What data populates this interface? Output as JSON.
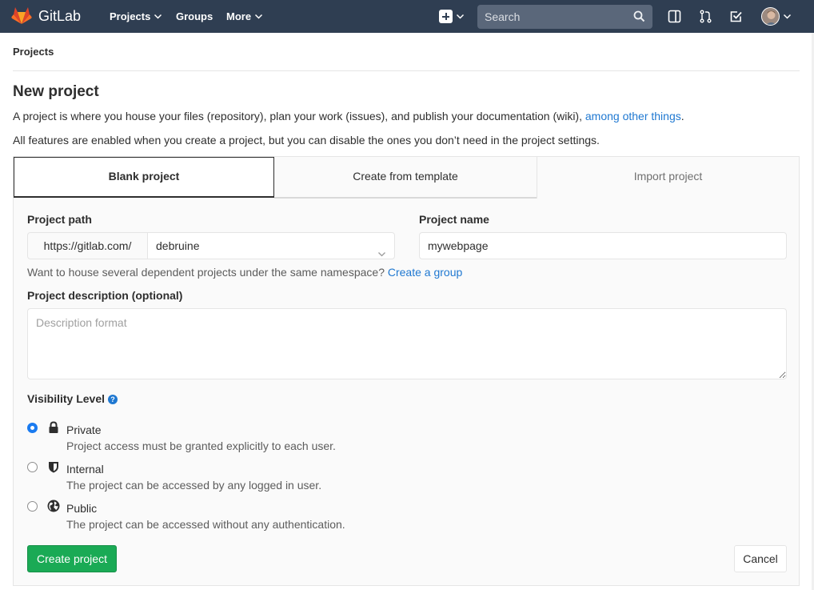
{
  "navbar": {
    "brand": "GitLab",
    "links": [
      {
        "label": "Projects",
        "has_dropdown": true
      },
      {
        "label": "Groups",
        "has_dropdown": false
      },
      {
        "label": "More",
        "has_dropdown": true
      }
    ],
    "search_placeholder": "Search",
    "icons": [
      "new-item-plus-icon",
      "search-icon",
      "sidebar-toggle-icon",
      "merge-requests-icon",
      "todos-check-icon",
      "user-avatar"
    ],
    "bg_color": "#2f3e52"
  },
  "breadcrumb": "Projects",
  "page": {
    "title": "New project",
    "intro_text": "A project is where you house your files (repository), plan your work (issues), and publish your documentation (wiki), ",
    "intro_link": "among other things",
    "intro_end": ".",
    "features_text": "All features are enabled when you create a project, but you can disable the ones you don’t need in the project settings."
  },
  "tabs": [
    {
      "label": "Blank project",
      "active": true
    },
    {
      "label": "Create from template",
      "active": false
    },
    {
      "label": "Import project",
      "active": false
    }
  ],
  "form": {
    "project_path_label": "Project path",
    "url_prefix": "https://gitlab.com/",
    "namespace": "debruine",
    "project_name_label": "Project name",
    "project_name_value": "mywebpage",
    "namespace_help": "Want to house several dependent projects under the same namespace?",
    "create_group_link": "Create a group",
    "description_label": "Project description (optional)",
    "description_placeholder": "Description format",
    "visibility_label": "Visibility Level",
    "visibility_help_icon": "?",
    "visibility_options": [
      {
        "title": "Private",
        "description": "Project access must be granted explicitly to each user.",
        "icon": "lock-icon",
        "checked": true
      },
      {
        "title": "Internal",
        "description": "The project can be accessed by any logged in user.",
        "icon": "shield-icon",
        "checked": false
      },
      {
        "title": "Public",
        "description": "The project can be accessed without any authentication.",
        "icon": "globe-icon",
        "checked": false
      }
    ],
    "create_button": "Create project",
    "cancel_button": "Cancel"
  },
  "colors": {
    "accent_link": "#1f78d1",
    "create_button": "#1aaa55",
    "radio_checked": "#1a7bf0"
  }
}
